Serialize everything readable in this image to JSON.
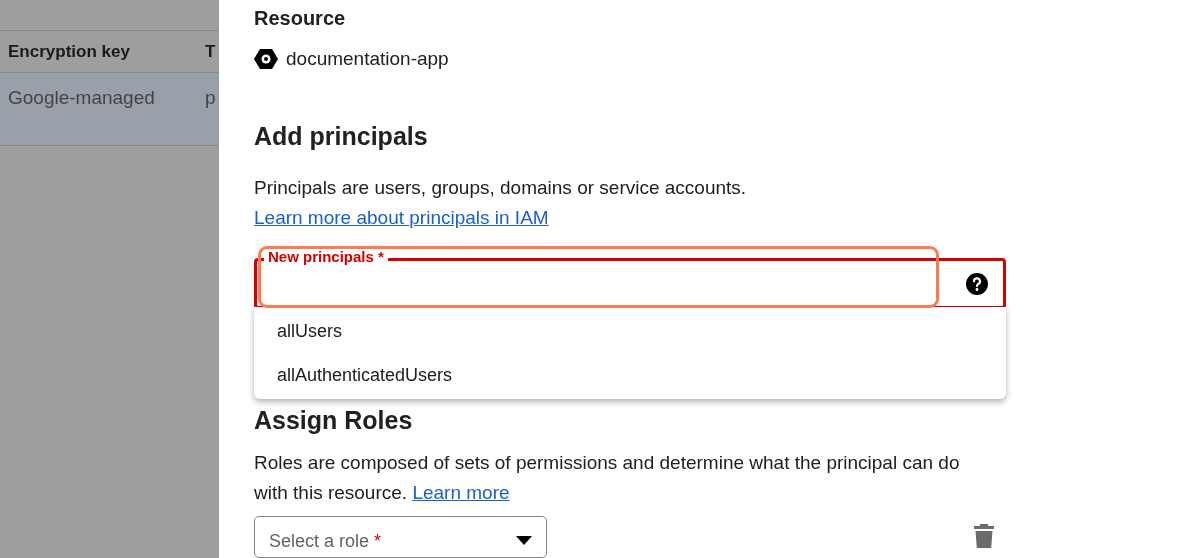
{
  "background_table": {
    "columns": [
      "Encryption key",
      "T"
    ],
    "rows": [
      [
        "Google-managed",
        "p"
      ]
    ]
  },
  "panel": {
    "resource_heading": "Resource",
    "resource_name": "documentation-app",
    "add_principals": {
      "heading": "Add principals",
      "description": "Principals are users, groups, domains or service accounts.",
      "link": "Learn more about principals in IAM",
      "field": {
        "label": "New principals",
        "required_mark": "*",
        "error": true
      },
      "suggestions": [
        "allUsers",
        "allAuthenticatedUsers"
      ]
    },
    "assign_roles": {
      "heading": "Assign Roles",
      "description": "Roles are composed of sets of permissions and determine what the principal can do with this resource.",
      "link": "Learn more",
      "role_select": {
        "placeholder": "Select a role",
        "required_mark": "*"
      }
    }
  }
}
